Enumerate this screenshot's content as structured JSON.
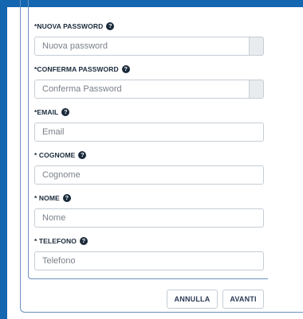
{
  "form": {
    "nuova_password": {
      "label": "*NUOVA PASSWORD",
      "placeholder": "Nuova password",
      "value": ""
    },
    "conferma_password": {
      "label": "*CONFERMA PASSWORD",
      "placeholder": "Conferma Password",
      "value": ""
    },
    "email": {
      "label": "*EMAIL",
      "placeholder": "Email",
      "value": ""
    },
    "cognome": {
      "label": "* COGNOME",
      "placeholder": "Cognome",
      "value": ""
    },
    "nome": {
      "label": "* NOME",
      "placeholder": "Nome",
      "value": ""
    },
    "telefono": {
      "label": "* TELEFONO",
      "placeholder": "Telefono",
      "value": ""
    },
    "help_glyph": "?"
  },
  "actions": {
    "annulla_label": "ANNULLA",
    "avanti_label": "AVANTI"
  },
  "colors": {
    "accent": "#1566b1",
    "text": "#1a2a3a",
    "border": "#c5cdd5"
  }
}
